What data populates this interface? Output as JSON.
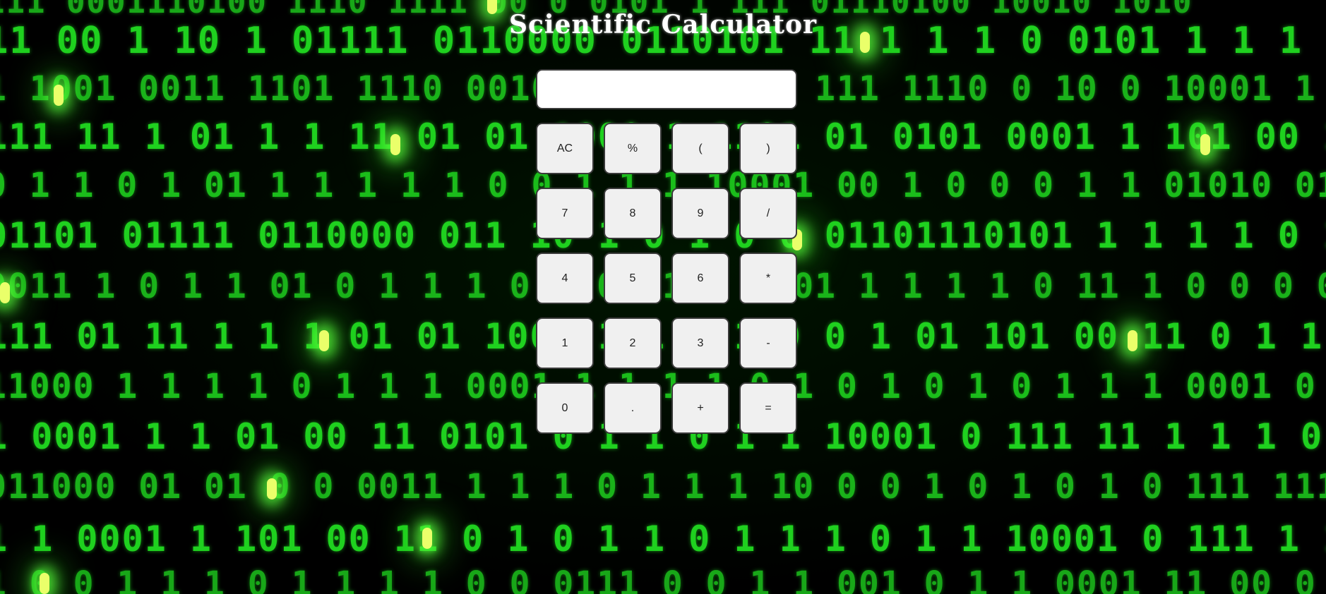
{
  "page": {
    "title": "Scientific Calculator"
  },
  "display": {
    "value": ""
  },
  "keys": {
    "ac": "AC",
    "percent": "%",
    "open_paren": "(",
    "close_paren": ")",
    "seven": "7",
    "eight": "8",
    "nine": "9",
    "divide": "/",
    "four": "4",
    "five": "5",
    "six": "6",
    "multiply": "*",
    "one": "1",
    "two": "2",
    "three": "3",
    "subtract": "-",
    "zero": "0",
    "decimal": ".",
    "add": "+",
    "equals": "="
  },
  "background": {
    "image": "green binary code matrix",
    "colors": {
      "digits": "#1fd11f",
      "glow": "#eaff6a",
      "base": "#000000"
    }
  },
  "colors": {
    "title": "#ffffff",
    "key_background": "#f0f0f0",
    "key_border": "#3a3a3a",
    "display_background": "#ffffff"
  }
}
